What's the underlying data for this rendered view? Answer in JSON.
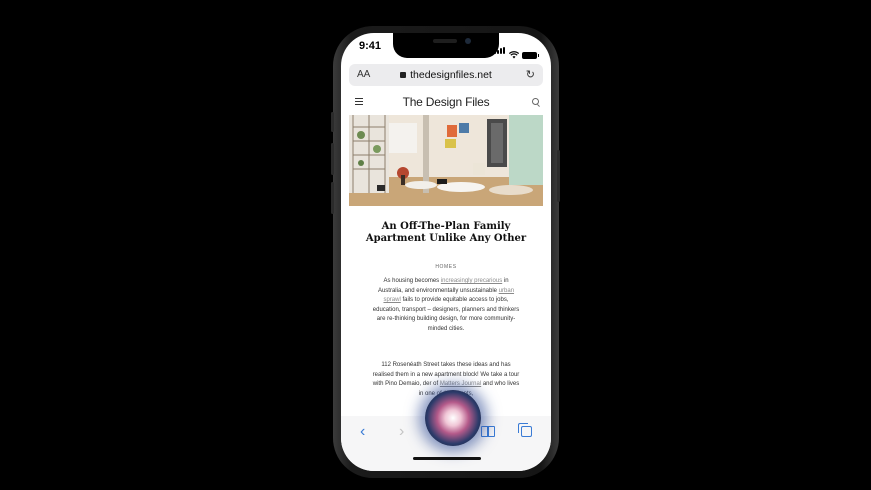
{
  "status_bar": {
    "time": "9:41"
  },
  "browser": {
    "text_size_label": "AA",
    "url": "thedesignfiles.net",
    "reload_label": "↻"
  },
  "site": {
    "logo": "The Design Files"
  },
  "article": {
    "title": "An Off-The-Plan Family Apartment Unlike Any Other",
    "category": "HOMES",
    "paragraph1": {
      "t1": "As housing becomes ",
      "l1": "increasingly precarious",
      "t2": " in Australia, and environmentally unsustainable ",
      "l2": "urban sprawl",
      "t3": " fails to provide equitable access to jobs, education, transport – designers, planners and thinkers are re-thinking building design, for more community-minded cities."
    },
    "paragraph2": {
      "t1": "112 Rosenéath Street takes these ideas and has realised them in a new apartment block! We take a tour with Pino Demaio, ",
      "t2": "der of ",
      "l1": "Matters Journal",
      "t3": " and ",
      "t4": " who lives in one of th",
      "t5": "artments,"
    }
  },
  "toolbar": {
    "back_icon": "‹",
    "forward_icon": "›"
  },
  "colors": {
    "accent": "#3a7bd5",
    "siri": "#b45a8a"
  }
}
